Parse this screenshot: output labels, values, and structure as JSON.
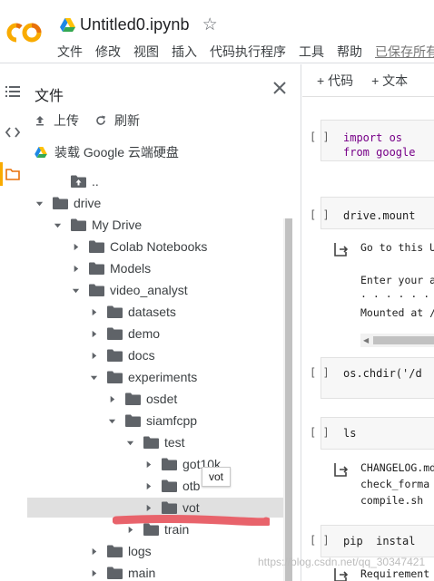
{
  "header": {
    "notebook_title": "Untitled0.ipynb",
    "menu": [
      "文件",
      "修改",
      "视图",
      "插入",
      "代码执行程序",
      "工具",
      "帮助"
    ],
    "saved_status": "已保存所有"
  },
  "files_panel": {
    "title": "文件",
    "upload_label": "上传",
    "refresh_label": "刷新",
    "mount_label": "装载 Google 云端硬盘",
    "tree": [
      {
        "label": "..",
        "depth": 1,
        "arrow": "none",
        "icon": "folder-up-icon"
      },
      {
        "label": "drive",
        "depth": 0,
        "arrow": "down",
        "icon": "folder-icon"
      },
      {
        "label": "My Drive",
        "depth": 1,
        "arrow": "down",
        "icon": "folder-icon"
      },
      {
        "label": "Colab Notebooks",
        "depth": 2,
        "arrow": "right",
        "icon": "folder-icon"
      },
      {
        "label": "Models",
        "depth": 2,
        "arrow": "right",
        "icon": "folder-icon"
      },
      {
        "label": "video_analyst",
        "depth": 2,
        "arrow": "down",
        "icon": "folder-icon"
      },
      {
        "label": "datasets",
        "depth": 3,
        "arrow": "right",
        "icon": "folder-icon"
      },
      {
        "label": "demo",
        "depth": 3,
        "arrow": "right",
        "icon": "folder-icon"
      },
      {
        "label": "docs",
        "depth": 3,
        "arrow": "right",
        "icon": "folder-icon"
      },
      {
        "label": "experiments",
        "depth": 3,
        "arrow": "down",
        "icon": "folder-icon"
      },
      {
        "label": "osdet",
        "depth": 4,
        "arrow": "right",
        "icon": "folder-icon"
      },
      {
        "label": "siamfcpp",
        "depth": 4,
        "arrow": "down",
        "icon": "folder-icon"
      },
      {
        "label": "test",
        "depth": 5,
        "arrow": "down",
        "icon": "folder-icon"
      },
      {
        "label": "got10k",
        "depth": 6,
        "arrow": "right",
        "icon": "folder-icon"
      },
      {
        "label": "otb",
        "depth": 6,
        "arrow": "right",
        "icon": "folder-icon"
      },
      {
        "label": "vot",
        "depth": 6,
        "arrow": "right",
        "icon": "folder-icon",
        "selected": true
      },
      {
        "label": "train",
        "depth": 5,
        "arrow": "right",
        "icon": "folder-icon"
      },
      {
        "label": "logs",
        "depth": 3,
        "arrow": "right",
        "icon": "folder-icon"
      },
      {
        "label": "main",
        "depth": 3,
        "arrow": "right",
        "icon": "folder-icon"
      }
    ],
    "tooltip": "vot"
  },
  "notebook": {
    "toolbar": {
      "code_label": "+ 代码",
      "text_label": "+ 文本"
    },
    "cells": [
      {
        "run": "[ ]",
        "lines": [
          "import os",
          "from google"
        ]
      },
      {
        "run": "[ ]",
        "lines": [
          "drive.mount"
        ],
        "output": [
          "Go to this U",
          "",
          "Enter your a",
          "· · · · · · ·",
          "Mounted at /"
        ]
      },
      {
        "run": "[ ]",
        "lines": [
          "os.chdir('/d"
        ]
      },
      {
        "run": "[ ]",
        "lines": [
          "ls"
        ],
        "output": [
          "CHANGELOG.md",
          "check_forma",
          "compile.sh"
        ]
      },
      {
        "run": "[ ]",
        "lines": [
          "pip  instal"
        ],
        "output": [
          "Requirement"
        ]
      }
    ]
  },
  "watermark": "https://blog.csdn.net/qq_30347421",
  "colors": {
    "accent": "#f9ab00",
    "logo_orange": "#f9ab00",
    "logo_dark_orange": "#e8710a",
    "folder": "#5f6368",
    "annotation_red": "#e8636b"
  }
}
